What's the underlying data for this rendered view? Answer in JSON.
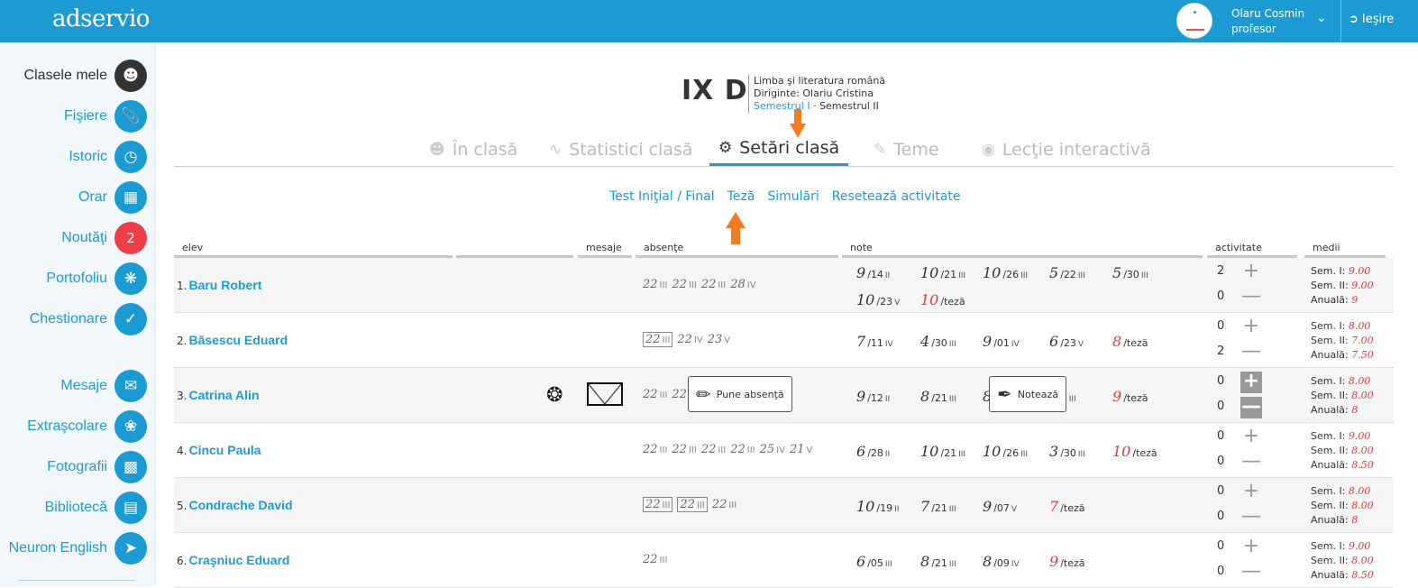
{
  "app": {
    "logo": "adservio",
    "user_name": "Olaru Cosmin",
    "user_role": "profesor",
    "logout": "Ieşire"
  },
  "sidebar": {
    "items": [
      {
        "label": "Clasele mele",
        "icon": "group-icon"
      },
      {
        "label": "Fişiere",
        "icon": "paperclip-icon"
      },
      {
        "label": "Istoric",
        "icon": "history-icon"
      },
      {
        "label": "Orar",
        "icon": "calendar-icon"
      },
      {
        "label": "Noutăţi",
        "icon": "badge-count",
        "count": "2"
      },
      {
        "label": "Portofoliu",
        "icon": "portfolio-icon"
      },
      {
        "label": "Chestionare",
        "icon": "checklist-icon"
      },
      {
        "label": "Mesaje",
        "icon": "mail-icon"
      },
      {
        "label": "Extraşcolare",
        "icon": "activities-icon"
      },
      {
        "label": "Fotografii",
        "icon": "photos-icon"
      },
      {
        "label": "Bibliotecă",
        "icon": "books-icon"
      },
      {
        "label": "Neuron English",
        "icon": "paper-plane-icon"
      }
    ]
  },
  "class": {
    "name": "IX D",
    "subject": "Limba şi literatura română",
    "diriginte": "Diriginte: Olariu Cristina",
    "sem1": "Semestrul I",
    "sem2": "· Semestrul II"
  },
  "tabs": [
    {
      "label": "În clasă",
      "icon": "group-icon"
    },
    {
      "label": "Statistici clasă",
      "icon": "chart-line-icon"
    },
    {
      "label": "Setări clasă",
      "icon": "gears-icon"
    },
    {
      "label": "Teme",
      "icon": "pencil-lines-icon"
    },
    {
      "label": "Lecţie interactivă",
      "icon": "webcam-icon"
    }
  ],
  "sublinks": [
    "Test Iniţial / Final",
    "Teză",
    "Simulări",
    "Resetează activitate"
  ],
  "columns": {
    "elev": "elev",
    "mesaje": "mesaje",
    "absente": "absenţe",
    "note": "note",
    "activitate": "activitate",
    "medii": "medii"
  },
  "labels": {
    "sem1": "Sem. I:",
    "sem2": "Sem. II:",
    "anuala": "Anuală:"
  },
  "tooltips": {
    "absenta": "Pune absenţă",
    "noteaza": "Notează"
  },
  "students": [
    {
      "num": "1.",
      "name": "Baru Robert",
      "abs": [
        {
          "d": "22",
          "m": "III"
        },
        {
          "d": "22",
          "m": "III"
        },
        {
          "d": "22",
          "m": "III"
        },
        {
          "d": "28",
          "m": "IV"
        }
      ],
      "notes": [
        {
          "v": "9",
          "d": "/14",
          "m": "II"
        },
        {
          "v": "10",
          "d": "/21",
          "m": "III"
        },
        {
          "v": "10",
          "d": "/26",
          "m": "III"
        },
        {
          "v": "5",
          "d": "/22",
          "m": "III"
        },
        {
          "v": "5",
          "d": "/30",
          "m": "III"
        },
        {
          "v": "10",
          "d": "/23",
          "m": "V"
        },
        {
          "v": "10",
          "d": "/teză",
          "m": "",
          "teza": true
        }
      ],
      "act_plus": "2",
      "act_minus": "0",
      "s1": "9.00",
      "s2": "9.00",
      "an": "9"
    },
    {
      "num": "2.",
      "name": "Băsescu Eduard",
      "abs": [
        {
          "d": "22",
          "m": "III",
          "boxed": true
        },
        {
          "d": "22",
          "m": "IV"
        },
        {
          "d": "23",
          "m": "V"
        }
      ],
      "notes": [
        {
          "v": "7",
          "d": "/11",
          "m": "IV"
        },
        {
          "v": "4",
          "d": "/30",
          "m": "III"
        },
        {
          "v": "9",
          "d": "/01",
          "m": "IV"
        },
        {
          "v": "6",
          "d": "/23",
          "m": "V"
        },
        {
          "v": "8",
          "d": "/teză",
          "m": "",
          "teza": true
        }
      ],
      "act_plus": "0",
      "act_minus": "2",
      "s1": "8.00",
      "s2": "7.00",
      "an": "7.50"
    },
    {
      "num": "3.",
      "name": "Catrina Alin",
      "abs": [
        {
          "d": "22",
          "m": "III"
        },
        {
          "d": "22",
          "m": ""
        }
      ],
      "notes": [
        {
          "v": "9",
          "d": "/12",
          "m": "II"
        },
        {
          "v": "8",
          "d": "/21",
          "m": "III"
        },
        {
          "v": "8",
          "d": "",
          "m": ""
        },
        {
          "v": "",
          "d": "/30",
          "m": "III"
        },
        {
          "v": "9",
          "d": "/teză",
          "m": "",
          "teza": true
        }
      ],
      "act_plus": "0",
      "act_minus": "0",
      "s1": "8.00",
      "s2": "8.00",
      "an": "8"
    },
    {
      "num": "4.",
      "name": "Cincu Paula",
      "abs": [
        {
          "d": "22",
          "m": "III"
        },
        {
          "d": "22",
          "m": "III"
        },
        {
          "d": "22",
          "m": "III"
        },
        {
          "d": "22",
          "m": "III"
        },
        {
          "d": "25",
          "m": "IV"
        },
        {
          "d": "21",
          "m": "V"
        }
      ],
      "notes": [
        {
          "v": "6",
          "d": "/28",
          "m": "II"
        },
        {
          "v": "10",
          "d": "/21",
          "m": "III"
        },
        {
          "v": "10",
          "d": "/26",
          "m": "III"
        },
        {
          "v": "3",
          "d": "/30",
          "m": "III"
        },
        {
          "v": "10",
          "d": "/teză",
          "m": "",
          "teza": true
        }
      ],
      "act_plus": "0",
      "act_minus": "0",
      "s1": "9.00",
      "s2": "8.00",
      "an": "8.50"
    },
    {
      "num": "5.",
      "name": "Condrache David",
      "abs": [
        {
          "d": "22",
          "m": "III",
          "boxed": true
        },
        {
          "d": "22",
          "m": "III",
          "boxed": true
        },
        {
          "d": "22",
          "m": "III"
        }
      ],
      "notes": [
        {
          "v": "10",
          "d": "/19",
          "m": "II"
        },
        {
          "v": "7",
          "d": "/21",
          "m": "III"
        },
        {
          "v": "9",
          "d": "/07",
          "m": "V"
        },
        {
          "v": "7",
          "d": "/teză",
          "m": "",
          "teza": true
        }
      ],
      "act_plus": "0",
      "act_minus": "0",
      "s1": "8.00",
      "s2": "8.00",
      "an": "8"
    },
    {
      "num": "6.",
      "name": "Craşniuc Eduard",
      "abs": [
        {
          "d": "22",
          "m": "III"
        }
      ],
      "notes": [
        {
          "v": "6",
          "d": "/05",
          "m": "III"
        },
        {
          "v": "8",
          "d": "/21",
          "m": "III"
        },
        {
          "v": "8",
          "d": "/09",
          "m": "IV"
        },
        {
          "v": "9",
          "d": "/teză",
          "m": "",
          "teza": true
        }
      ],
      "act_plus": "0",
      "act_minus": "0",
      "s1": "9.00",
      "s2": "8.00",
      "an": "8.50"
    }
  ]
}
